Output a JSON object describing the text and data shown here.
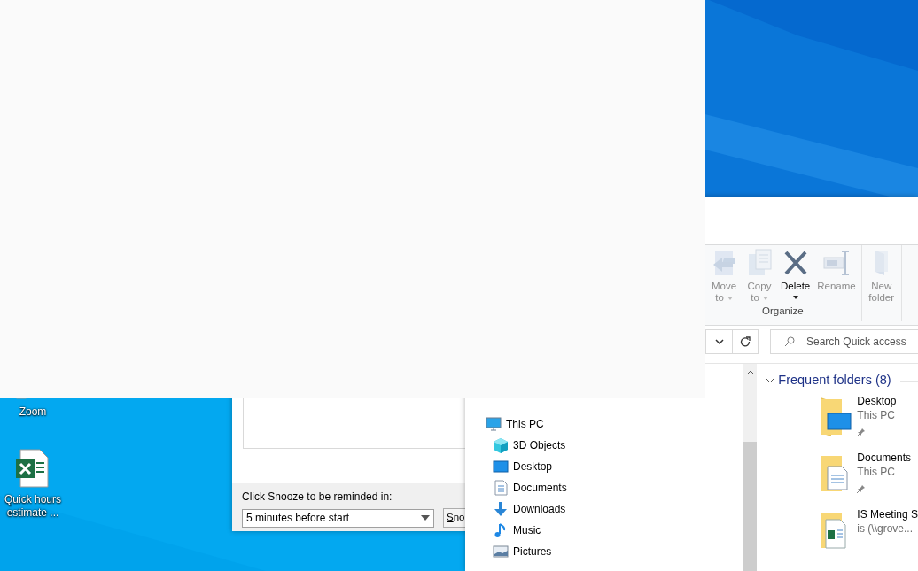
{
  "desktop_icons": [
    {
      "label": "Zoom",
      "kind": "app"
    },
    {
      "label": "Quick hours estimate ...",
      "kind": "spreadsheet"
    }
  ],
  "reminder": {
    "prompt": "Click Snooze to be reminded in:",
    "snooze_time": "5 minutes before start",
    "snooze_button": "Sno"
  },
  "explorer": {
    "ribbon": {
      "groups": [
        {
          "label": "Organize",
          "buttons": [
            {
              "lines": [
                "Move",
                "to"
              ],
              "kind": "move",
              "menu": true,
              "disabled": true
            },
            {
              "lines": [
                "Copy",
                "to"
              ],
              "kind": "copy",
              "menu": true,
              "disabled": true
            },
            {
              "lines": [
                "Delete"
              ],
              "kind": "delete",
              "menu": true,
              "disabled": false
            },
            {
              "lines": [
                "Rename"
              ],
              "kind": "rename",
              "menu": false,
              "disabled": true
            }
          ]
        },
        {
          "buttons": [
            {
              "lines": [
                "New",
                "folder"
              ],
              "kind": "newfolder",
              "menu": false,
              "disabled": true
            }
          ]
        }
      ]
    },
    "search": {
      "placeholder": "Search Quick access"
    },
    "nav_pane": {
      "items": [
        {
          "label": "This PC",
          "kind": "pc",
          "children": [
            {
              "label": "3D Objects",
              "kind": "objects3d"
            },
            {
              "label": "Desktop",
              "kind": "desktop"
            },
            {
              "label": "Documents",
              "kind": "documents"
            },
            {
              "label": "Downloads",
              "kind": "downloads"
            },
            {
              "label": "Music",
              "kind": "music"
            },
            {
              "label": "Pictures",
              "kind": "pictures"
            }
          ]
        }
      ]
    },
    "frequent": {
      "title": "Frequent folders (8)",
      "expanded": true,
      "folders": [
        {
          "name": "Desktop",
          "location": "This PC",
          "pinned": true,
          "kind": "desktop"
        },
        {
          "name": "Documents",
          "location": "This PC",
          "pinned": true,
          "kind": "documents"
        },
        {
          "name": "IS Meeting S",
          "location": "is (\\\\grove...",
          "pinned": false,
          "kind": "spreadsheet"
        }
      ]
    }
  }
}
